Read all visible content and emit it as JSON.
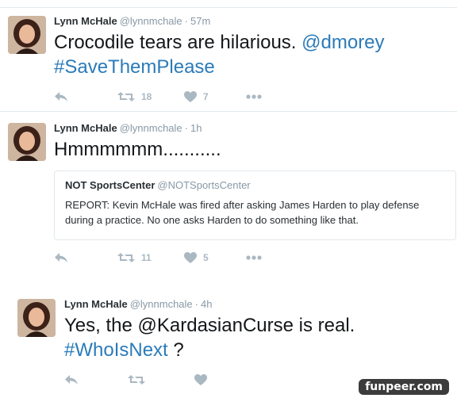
{
  "tweets": [
    {
      "name": "Lynn McHale",
      "handle": "@lynnmchale",
      "separator": "·",
      "time": "57m",
      "text_lines": [
        [
          {
            "t": "Crocodile tears are hilarious. ",
            "link": false
          },
          {
            "t": "@dmorey",
            "link": true
          }
        ],
        [
          {
            "t": "#SaveThemPlease",
            "link": true
          }
        ]
      ],
      "retweets": "18",
      "likes": "7"
    },
    {
      "name": "Lynn McHale",
      "handle": "@lynnmchale",
      "separator": "·",
      "time": "1h",
      "text_lines": [
        [
          {
            "t": "Hmmmmmm...........",
            "link": false
          }
        ]
      ],
      "quote": {
        "name": "NOT SportsCenter",
        "handle": "@NOTSportsCenter",
        "text": "REPORT: Kevin McHale was fired after asking James Harden to play defense during a practice. No one asks Harden to do something like that."
      },
      "retweets": "11",
      "likes": "5"
    },
    {
      "name": "Lynn McHale",
      "handle": "@lynnmchale",
      "separator": "·",
      "time": "4h",
      "text_lines": [
        [
          {
            "t": "Yes, the @KardasianCurse is real.",
            "link": false
          }
        ],
        [
          {
            "t": "#WhoIsNext",
            "link": true
          },
          {
            "t": " ?",
            "link": false
          }
        ]
      ],
      "retweets": "",
      "likes": ""
    }
  ],
  "icons": {
    "reply": "reply-icon",
    "retweet": "retweet-icon",
    "like": "heart-icon",
    "more": "more-icon"
  },
  "colors": {
    "link": "#2b7bb9",
    "icon": "#aab8c2",
    "secondary_text": "#8899a6"
  },
  "watermark": "funpeer.com"
}
